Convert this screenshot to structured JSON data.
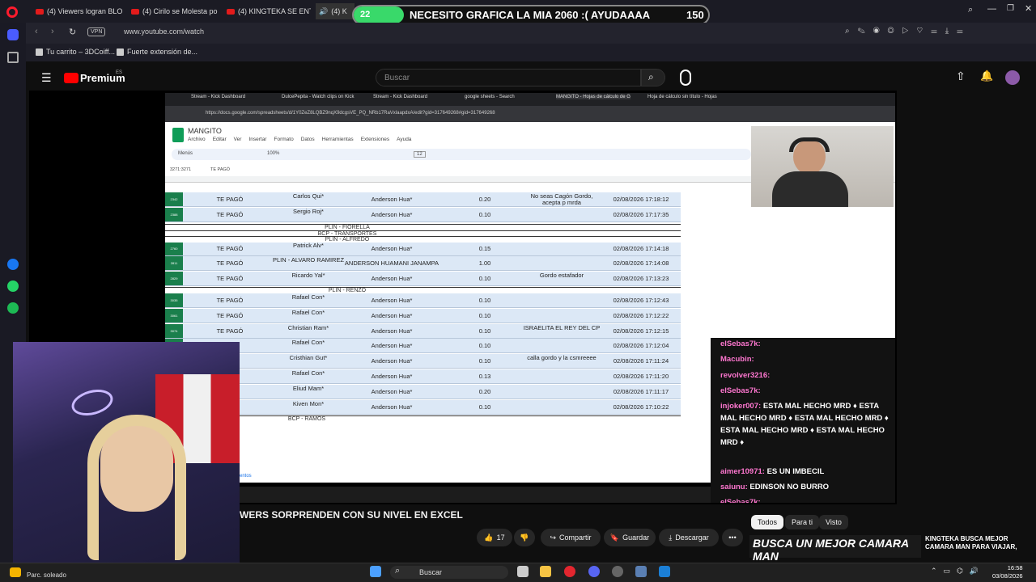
{
  "browser": {
    "tabs": [
      {
        "label": "(4) Viewers logran BLO"
      },
      {
        "label": "(4) Cirilo se Molesta po"
      },
      {
        "label": "(4) KINGTEKA SE ENTERA"
      },
      {
        "label": "(4) K"
      }
    ],
    "vpn_label": "VPN",
    "url": "www.youtube.com/watch",
    "bookmarks": [
      {
        "label": "Tu carrito – 3DCoiff..."
      },
      {
        "label": "Fuerte extensión de..."
      }
    ]
  },
  "overlay_banner": {
    "count": "22",
    "text": "NECESITO GRAFICA LA MIA 2060 :( AYUDAAAA",
    "number": "150"
  },
  "youtube": {
    "logo": "Premium",
    "logo_region": "ES",
    "search_placeholder": "Buscar",
    "video_title": "WERS SORPRENDEN CON SU NIVEL EN EXCEL",
    "actions": {
      "likes": "17",
      "share": "Compartir",
      "save": "Guardar",
      "download": "Descargar",
      "more": "•••"
    },
    "filter_chips": [
      "Todos",
      "Para ti",
      "Visto"
    ],
    "promo_title": "BUSCA UN MEJOR CAMARA MAN",
    "promo_side": "KINGTEKA BUSCA MEJOR CAMARA MAN PARA VIAJAR,"
  },
  "inner_browser": {
    "tabs": [
      "Stream - Kick Dashboard",
      "DulcePepita - Watch clips on Kick",
      "Stream - Kick Dashboard",
      "google sheets - Search",
      "MANGITO - Hojas de cálculo de G",
      "Hoja de cálculo sin título - Hojas"
    ],
    "url": "https://docs.google.com/spreadsheets/d/1Y0ZeZ8LQBZ9nqX9dcgsVE_PQ_NRb17RaVxlaapdxA/edit?gid=317649268#gid=317649268"
  },
  "sheet": {
    "title": "MANGITO",
    "menu": [
      "Archivo",
      "Editar",
      "Ver",
      "Insertar",
      "Formato",
      "Datos",
      "Herramientas",
      "Extensiones",
      "Ayuda"
    ],
    "toolbar": {
      "menus": "Menús",
      "zoom": "100%",
      "font_size": "12"
    },
    "cell_ref": "3271:3271",
    "cell_value": "TE PAGÓ",
    "sheet_tab": "entos",
    "rows": [
      {
        "num": "2342",
        "status": "TE PAGÓ",
        "name": "Carlos Qui*",
        "payee": "Anderson Hua*",
        "amount": "0.20",
        "note": "No seas Cagón Gordo, acepta p mrda",
        "date": "02/08/2026 17:18:12"
      },
      {
        "num": "2388",
        "status": "TE PAGÓ",
        "name": "Sergio Roj*",
        "payee": "Anderson Hua*",
        "amount": "0.10",
        "note": "",
        "date": "02/08/2026 17:17:35"
      },
      {
        "num": "2760",
        "status": "TE PAGÓ",
        "name": "Patrick Alv*",
        "payee": "Anderson Hua*",
        "amount": "0.15",
        "note": "",
        "date": "02/08/2026 17:14:18"
      },
      {
        "num": "2811",
        "status": "TE PAGÓ",
        "name": "PLIN - ALVARO RAMIREZ",
        "payee": "ANDERSON HUAMANI JANAMPA",
        "amount": "1.00",
        "note": "",
        "date": "02/08/2026 17:14:08"
      },
      {
        "num": "2829",
        "status": "TE PAGÓ",
        "name": "Ricardo Yal*",
        "payee": "Anderson Hua*",
        "amount": "0.10",
        "note": "Gordo estafador",
        "date": "02/08/2026 17:13:23"
      },
      {
        "num": "3035",
        "status": "TE PAGÓ",
        "name": "Rafael Con*",
        "payee": "Anderson Hua*",
        "amount": "0.10",
        "note": "",
        "date": "02/08/2026 17:12:43"
      },
      {
        "num": "3061",
        "status": "TE PAGÓ",
        "name": "Rafael Con*",
        "payee": "Anderson Hua*",
        "amount": "0.10",
        "note": "",
        "date": "02/08/2026 17:12:22"
      },
      {
        "num": "3074",
        "status": "TE PAGÓ",
        "name": "Christian Ram*",
        "payee": "Anderson Hua*",
        "amount": "0.10",
        "note": "ISRAELITA EL REY DEL CP",
        "date": "02/08/2026 17:12:15"
      },
      {
        "num": "",
        "status": "",
        "name": "Rafael Con*",
        "payee": "Anderson Hua*",
        "amount": "0.10",
        "note": "",
        "date": "02/08/2026 17:12:04"
      },
      {
        "num": "",
        "status": "",
        "name": "Cristhian Gut*",
        "payee": "Anderson Hua*",
        "amount": "0.10",
        "note": "calla gordo y la csmreeee",
        "date": "02/08/2026 17:11:24"
      },
      {
        "num": "",
        "status": "",
        "name": "Rafael Con*",
        "payee": "Anderson Hua*",
        "amount": "0.13",
        "note": "",
        "date": "02/08/2026 17:11:20"
      },
      {
        "num": "",
        "status": "",
        "name": "Eliud Mam*",
        "payee": "Anderson Hua*",
        "amount": "0.20",
        "note": "",
        "date": "02/08/2026 17:11:17"
      },
      {
        "num": "",
        "status": "",
        "name": "Kiven Mon*",
        "payee": "Anderson Hua*",
        "amount": "0.10",
        "note": "",
        "date": "02/08/2026 17:10:22"
      }
    ],
    "separators": {
      "sep1": "PLIN - FIORELLA",
      "sep2": "BCP - TRANSPORTES",
      "sep3": "PLIN - ALFREDO",
      "sep4": "PLIN - RENZO",
      "sep5": "BCP - RAMOS"
    }
  },
  "chat": {
    "messages": [
      {
        "user": "elSebas7k:",
        "text": ""
      },
      {
        "user": "Macubin:",
        "text": ""
      },
      {
        "user": "revolver3216:",
        "text": ""
      },
      {
        "user": "elSebas7k:",
        "text": ""
      },
      {
        "user": "injoker007:",
        "text": "ESTA MAL HECHO MRD ♦ ESTA MAL HECHO MRD ♦ ESTA MAL HECHO MRD ♦ ESTA MAL HECHO MRD ♦ ESTA MAL HECHO MRD ♦"
      },
      {
        "user": "aimer10971:",
        "text": "ES UN IMBECIL"
      },
      {
        "user": "saiunu:",
        "text": "EDINSON NO BURRO"
      },
      {
        "user": "elSebas7k:",
        "text": ""
      }
    ]
  },
  "taskbar": {
    "weather": "Parc. soleado",
    "search": "Buscar",
    "time": "16:58",
    "date": "03/08/2026"
  },
  "colors": {
    "youtube_red": "#ff0000",
    "sheet_row_bg": "#dce8f6",
    "row_num_green": "#1a7f4c",
    "chat_user_pink": "#ff77d0",
    "banner_green": "#39d96a"
  }
}
